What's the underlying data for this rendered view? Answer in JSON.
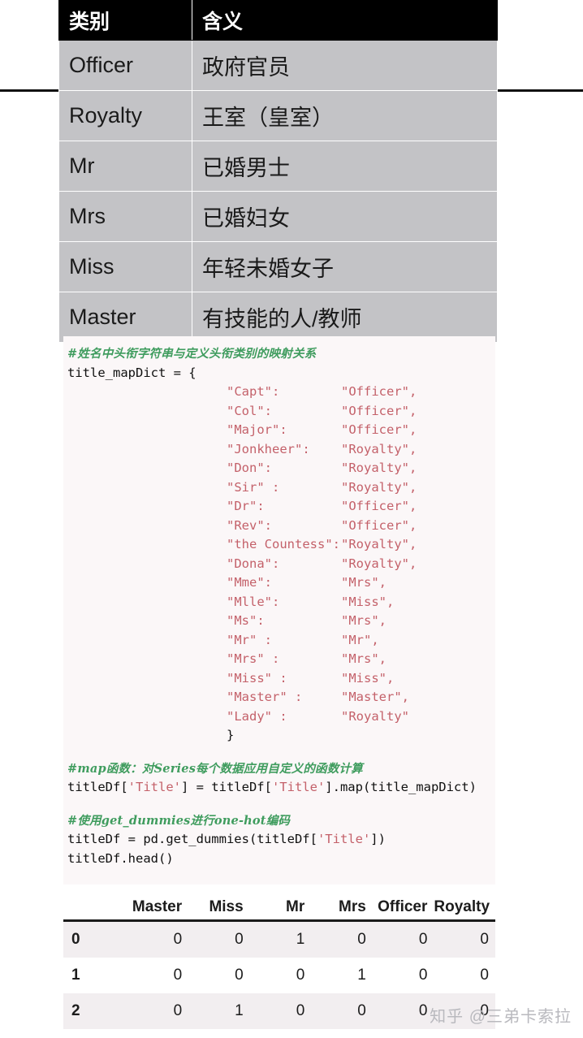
{
  "definition_table": {
    "headers": [
      "类别",
      "含义"
    ],
    "rows": [
      {
        "category": "Officer",
        "meaning": "政府官员"
      },
      {
        "category": "Royalty",
        "meaning": "王室（皇室）"
      },
      {
        "category": "Mr",
        "meaning": "已婚男士"
      },
      {
        "category": "Mrs",
        "meaning": "已婚妇女"
      },
      {
        "category": "Miss",
        "meaning": "年轻未婚女子"
      },
      {
        "category": "Master",
        "meaning": "有技能的人/教师"
      }
    ]
  },
  "code": {
    "comment1": "#姓名中头衔字符串与定义头衔类别的映射关系",
    "dict_decl": "title_mapDict = {",
    "dict_entries": [
      {
        "key": "\"Capt\":",
        "value": "\"Officer\","
      },
      {
        "key": "\"Col\":",
        "value": "\"Officer\","
      },
      {
        "key": "\"Major\":",
        "value": "\"Officer\","
      },
      {
        "key": "\"Jonkheer\":",
        "value": "\"Royalty\","
      },
      {
        "key": "\"Don\":",
        "value": "\"Royalty\","
      },
      {
        "key": "\"Sir\" :",
        "value": "\"Royalty\","
      },
      {
        "key": "\"Dr\":",
        "value": "\"Officer\","
      },
      {
        "key": "\"Rev\":",
        "value": "\"Officer\","
      },
      {
        "key": "\"the Countess\":",
        "value": "\"Royalty\","
      },
      {
        "key": "\"Dona\":",
        "value": "\"Royalty\","
      },
      {
        "key": "\"Mme\":",
        "value": "\"Mrs\","
      },
      {
        "key": "\"Mlle\":",
        "value": "\"Miss\","
      },
      {
        "key": "\"Ms\":",
        "value": "\"Mrs\","
      },
      {
        "key": "\"Mr\" :",
        "value": "\"Mr\","
      },
      {
        "key": "\"Mrs\" :",
        "value": "\"Mrs\","
      },
      {
        "key": "\"Miss\" :",
        "value": "\"Miss\","
      },
      {
        "key": "\"Master\" :",
        "value": "\"Master\","
      },
      {
        "key": "\"Lady\" :",
        "value": "\"Royalty\""
      }
    ],
    "dict_close": "}",
    "comment2": "#map函数：对Series每个数据应用自定义的函数计算",
    "line_map_a": "titleDf[",
    "line_map_str1": "'Title'",
    "line_map_b": "] = titleDf[",
    "line_map_str2": "'Title'",
    "line_map_c": "].map(title_mapDict)",
    "comment3": "#使用get_dummies进行one-hot编码",
    "line_dum_a": "titleDf = pd.get_dummies(titleDf[",
    "line_dum_str": "'Title'",
    "line_dum_b": "])",
    "line_head": "titleDf.head()"
  },
  "dataframe": {
    "index_header": "",
    "columns": [
      "Master",
      "Miss",
      "Mr",
      "Mrs",
      "Officer",
      "Royalty"
    ],
    "rows": [
      {
        "index": "0",
        "values": [
          "0",
          "0",
          "1",
          "0",
          "0",
          "0"
        ]
      },
      {
        "index": "1",
        "values": [
          "0",
          "0",
          "0",
          "1",
          "0",
          "0"
        ]
      },
      {
        "index": "2",
        "values": [
          "0",
          "1",
          "0",
          "0",
          "0",
          "0"
        ]
      }
    ]
  },
  "watermark": {
    "text": "知乎 @三弟卡索拉"
  },
  "colors": {
    "header_bg": "#000000",
    "row_bg": "#c3c3c6",
    "code_bg": "#fbf7f8",
    "string_color": "#c4616a",
    "comment_color": "#3f9c5e"
  }
}
